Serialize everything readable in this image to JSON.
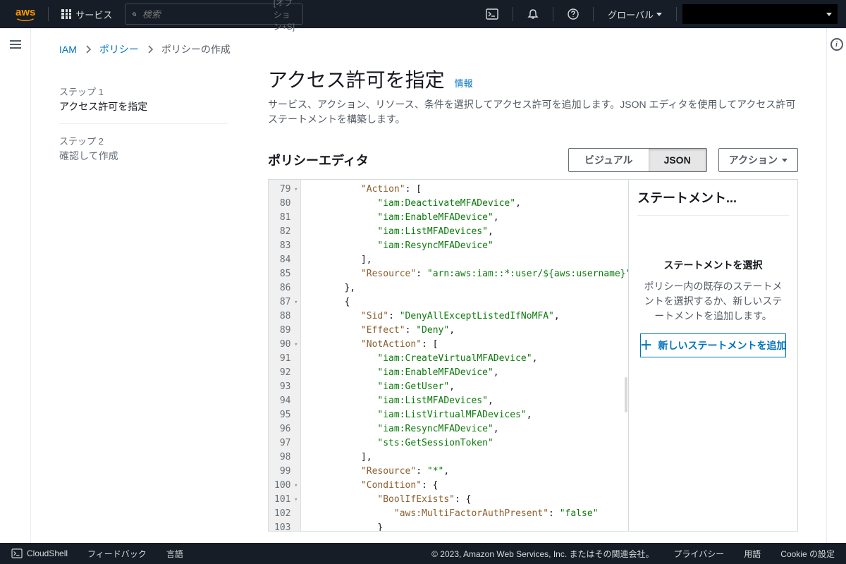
{
  "topnav": {
    "services": "サービス",
    "search_placeholder": "検索",
    "search_hint": "[オプション+S]",
    "region": "グローバル"
  },
  "breadcrumbs": {
    "root": "IAM",
    "policies": "ポリシー",
    "current": "ポリシーの作成"
  },
  "steps": {
    "s1_label": "ステップ 1",
    "s1_title": "アクセス許可を指定",
    "s2_label": "ステップ 2",
    "s2_title": "確認して作成"
  },
  "header": {
    "title": "アクセス許可を指定",
    "info": "情報",
    "desc": "サービス、アクション、リソース、条件を選択してアクセス許可を追加します。JSON エディタを使用してアクセス許可ステートメントを構築します。"
  },
  "editor": {
    "title": "ポリシーエディタ",
    "visual": "ビジュアル",
    "json": "JSON",
    "actions": "アクション"
  },
  "code": {
    "lines": [
      {
        "n": 79,
        "fold": true,
        "indent": 3,
        "seg": [
          {
            "t": "k",
            "v": "\"Action\""
          },
          {
            "t": "p",
            "v": ": ["
          }
        ]
      },
      {
        "n": 80,
        "fold": false,
        "indent": 4,
        "seg": [
          {
            "t": "s",
            "v": "\"iam:DeactivateMFADevice\""
          },
          {
            "t": "p",
            "v": ","
          }
        ]
      },
      {
        "n": 81,
        "fold": false,
        "indent": 4,
        "seg": [
          {
            "t": "s",
            "v": "\"iam:EnableMFADevice\""
          },
          {
            "t": "p",
            "v": ","
          }
        ]
      },
      {
        "n": 82,
        "fold": false,
        "indent": 4,
        "seg": [
          {
            "t": "s",
            "v": "\"iam:ListMFADevices\""
          },
          {
            "t": "p",
            "v": ","
          }
        ]
      },
      {
        "n": 83,
        "fold": false,
        "indent": 4,
        "seg": [
          {
            "t": "s",
            "v": "\"iam:ResyncMFADevice\""
          }
        ]
      },
      {
        "n": 84,
        "fold": false,
        "indent": 3,
        "seg": [
          {
            "t": "p",
            "v": "],"
          }
        ]
      },
      {
        "n": 85,
        "fold": false,
        "indent": 3,
        "seg": [
          {
            "t": "k",
            "v": "\"Resource\""
          },
          {
            "t": "p",
            "v": ": "
          },
          {
            "t": "s",
            "v": "\"arn:aws:iam::*:user/${aws:username}\""
          }
        ]
      },
      {
        "n": 86,
        "fold": false,
        "indent": 2,
        "seg": [
          {
            "t": "p",
            "v": "},"
          }
        ]
      },
      {
        "n": 87,
        "fold": true,
        "indent": 2,
        "seg": [
          {
            "t": "p",
            "v": "{"
          }
        ]
      },
      {
        "n": 88,
        "fold": false,
        "indent": 3,
        "seg": [
          {
            "t": "k",
            "v": "\"Sid\""
          },
          {
            "t": "p",
            "v": ": "
          },
          {
            "t": "s",
            "v": "\"DenyAllExceptListedIfNoMFA\""
          },
          {
            "t": "p",
            "v": ","
          }
        ]
      },
      {
        "n": 89,
        "fold": false,
        "indent": 3,
        "seg": [
          {
            "t": "k",
            "v": "\"Effect\""
          },
          {
            "t": "p",
            "v": ": "
          },
          {
            "t": "s",
            "v": "\"Deny\""
          },
          {
            "t": "p",
            "v": ","
          }
        ]
      },
      {
        "n": 90,
        "fold": true,
        "indent": 3,
        "seg": [
          {
            "t": "k",
            "v": "\"NotAction\""
          },
          {
            "t": "p",
            "v": ": ["
          }
        ]
      },
      {
        "n": 91,
        "fold": false,
        "indent": 4,
        "seg": [
          {
            "t": "s",
            "v": "\"iam:CreateVirtualMFADevice\""
          },
          {
            "t": "p",
            "v": ","
          }
        ]
      },
      {
        "n": 92,
        "fold": false,
        "indent": 4,
        "seg": [
          {
            "t": "s",
            "v": "\"iam:EnableMFADevice\""
          },
          {
            "t": "p",
            "v": ","
          }
        ]
      },
      {
        "n": 93,
        "fold": false,
        "indent": 4,
        "seg": [
          {
            "t": "s",
            "v": "\"iam:GetUser\""
          },
          {
            "t": "p",
            "v": ","
          }
        ]
      },
      {
        "n": 94,
        "fold": false,
        "indent": 4,
        "seg": [
          {
            "t": "s",
            "v": "\"iam:ListMFADevices\""
          },
          {
            "t": "p",
            "v": ","
          }
        ]
      },
      {
        "n": 95,
        "fold": false,
        "indent": 4,
        "seg": [
          {
            "t": "s",
            "v": "\"iam:ListVirtualMFADevices\""
          },
          {
            "t": "p",
            "v": ","
          }
        ]
      },
      {
        "n": 96,
        "fold": false,
        "indent": 4,
        "seg": [
          {
            "t": "s",
            "v": "\"iam:ResyncMFADevice\""
          },
          {
            "t": "p",
            "v": ","
          }
        ]
      },
      {
        "n": 97,
        "fold": false,
        "indent": 4,
        "seg": [
          {
            "t": "s",
            "v": "\"sts:GetSessionToken\""
          }
        ]
      },
      {
        "n": 98,
        "fold": false,
        "indent": 3,
        "seg": [
          {
            "t": "p",
            "v": "],"
          }
        ]
      },
      {
        "n": 99,
        "fold": false,
        "indent": 3,
        "seg": [
          {
            "t": "k",
            "v": "\"Resource\""
          },
          {
            "t": "p",
            "v": ": "
          },
          {
            "t": "s",
            "v": "\"*\""
          },
          {
            "t": "p",
            "v": ","
          }
        ]
      },
      {
        "n": 100,
        "fold": true,
        "indent": 3,
        "seg": [
          {
            "t": "k",
            "v": "\"Condition\""
          },
          {
            "t": "p",
            "v": ": {"
          }
        ]
      },
      {
        "n": 101,
        "fold": true,
        "indent": 4,
        "seg": [
          {
            "t": "k",
            "v": "\"BoolIfExists\""
          },
          {
            "t": "p",
            "v": ": {"
          }
        ]
      },
      {
        "n": 102,
        "fold": false,
        "indent": 5,
        "seg": [
          {
            "t": "k",
            "v": "\"aws:MultiFactorAuthPresent\""
          },
          {
            "t": "p",
            "v": ": "
          },
          {
            "t": "s",
            "v": "\"false\""
          }
        ]
      },
      {
        "n": 103,
        "fold": false,
        "indent": 4,
        "seg": [
          {
            "t": "p",
            "v": "}"
          }
        ]
      }
    ]
  },
  "stmt": {
    "title": "ステートメント",
    "empty_h": "ステートメントを選択",
    "empty_p": "ポリシー内の既存のステートメントを選択するか、新しいステートメントを追加します。",
    "add": "新しいステートメントを追加"
  },
  "footer": {
    "cloudshell": "CloudShell",
    "feedback": "フィードバック",
    "language": "言語",
    "copyright": "© 2023, Amazon Web Services, Inc. またはその関連会社。",
    "privacy": "プライバシー",
    "terms": "用語",
    "cookies": "Cookie の設定"
  }
}
